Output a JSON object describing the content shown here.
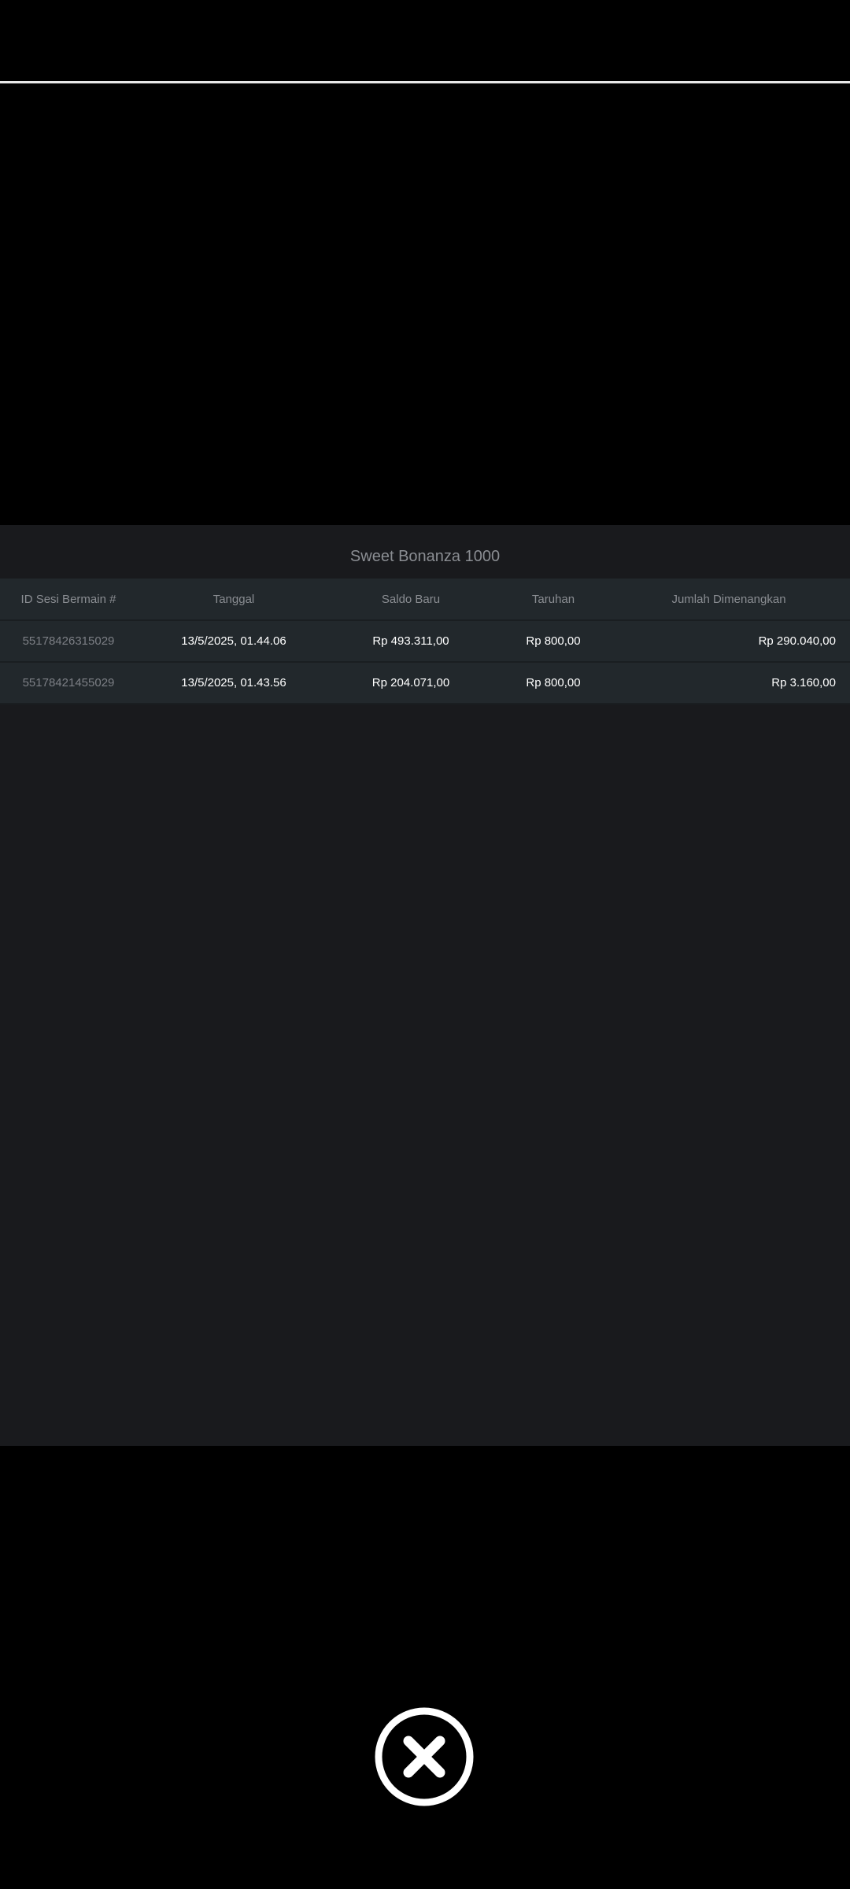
{
  "title": "Sweet Bonanza 1000",
  "table": {
    "headers": [
      "ID Sesi Bermain #",
      "Tanggal",
      "Saldo Baru",
      "Taruhan",
      "Jumlah Dimenangkan"
    ],
    "rows": [
      [
        "55178426315029",
        "13/5/2025, 01.44.06",
        "Rp 493.311,00",
        "Rp 800,00",
        "Rp 290.040,00"
      ],
      [
        "55178421455029",
        "13/5/2025, 01.43.56",
        "Rp 204.071,00",
        "Rp 800,00",
        "Rp 3.160,00"
      ]
    ]
  },
  "icons": {
    "close": "close-circle-icon"
  },
  "colors": {
    "background": "#000000",
    "panel": "#191a1d",
    "row": "#22282c",
    "muted_text": "#8a8d92",
    "value_text": "#ffffff"
  }
}
